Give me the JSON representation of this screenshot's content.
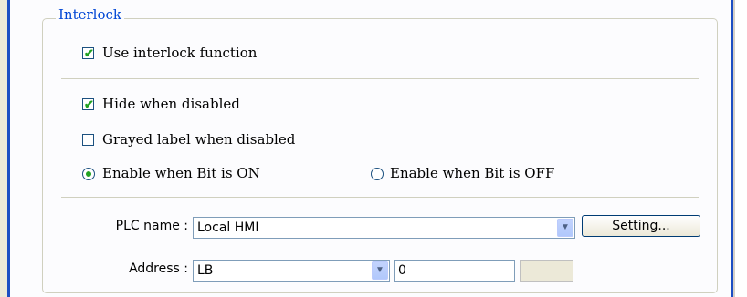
{
  "interlock": {
    "group_title": "Interlock",
    "use_interlock": {
      "label": "Use interlock function",
      "checked": true
    },
    "hide_when_disabled": {
      "label": "Hide when disabled",
      "checked": true
    },
    "grayed_label": {
      "label": "Grayed label when disabled",
      "checked": false
    },
    "enable_on": {
      "label": "Enable when Bit is ON",
      "selected": true
    },
    "enable_off": {
      "label": "Enable when Bit is OFF",
      "selected": false
    },
    "plc_name": {
      "label": "PLC name :",
      "value": "Local HMI"
    },
    "setting_button": "Setting...",
    "address": {
      "label": "Address :",
      "device": "LB",
      "value": "0"
    }
  }
}
